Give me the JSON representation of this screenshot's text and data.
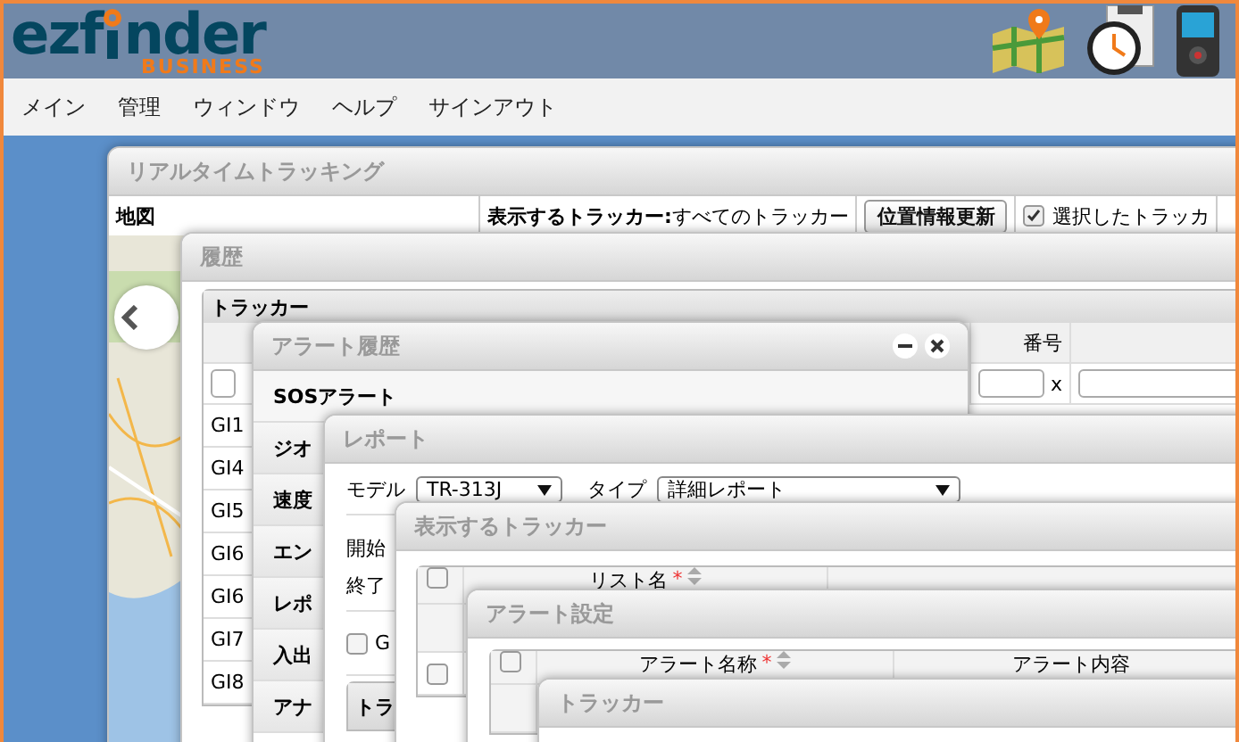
{
  "logo": {
    "wordmark_left": "ezf",
    "wordmark_right": "nder",
    "tagline": "BUSINESS"
  },
  "menu": [
    {
      "label": "メイン"
    },
    {
      "label": "管理"
    },
    {
      "label": "ウィンドウ"
    },
    {
      "label": "ヘルプ"
    },
    {
      "label": "サインアウト"
    }
  ],
  "tracking_window": {
    "title": "リアルタイムトラッキング",
    "map_tab": "地図",
    "tracker_label": "表示するトラッカー:",
    "tracker_value": "すべてのトラッカー",
    "refresh_button": "位置情報更新",
    "selected_only": {
      "label": "選択したトラッカ",
      "checked": true
    }
  },
  "history_window": {
    "title": "履歴",
    "panel_title": "トラッカー",
    "column": "番号",
    "clear_button": "x",
    "rows": [
      "GI1",
      "GI4",
      "GI5",
      "GI6",
      "GI6",
      "GI7",
      "GI8"
    ]
  },
  "alert_history_window": {
    "title": "アラート履歴",
    "items": [
      "SOSアラート",
      "ジオ",
      "速度",
      "エン",
      "レポ",
      "入出",
      "アナ"
    ]
  },
  "report_window": {
    "title": "レポート",
    "model_label": "モデル",
    "model_value": "TR-313J",
    "type_label": "タイプ",
    "type_value": "詳細レポート",
    "start_label": "開始",
    "end_label": "終了",
    "gps_option": {
      "label": "G",
      "checked": false
    },
    "panel_title": "トラ"
  },
  "display_trackers_window": {
    "title": "表示するトラッカー",
    "column": "リスト名",
    "required": "*",
    "all_checked": false,
    "rows": [
      {
        "checked": false
      }
    ]
  },
  "alert_settings_window": {
    "title": "アラート設定",
    "all_checked": false,
    "columns": [
      {
        "label": "アラート名称",
        "required": "*"
      },
      {
        "label": "アラート内容"
      }
    ]
  },
  "tracker_window": {
    "title": "トラッカー"
  }
}
